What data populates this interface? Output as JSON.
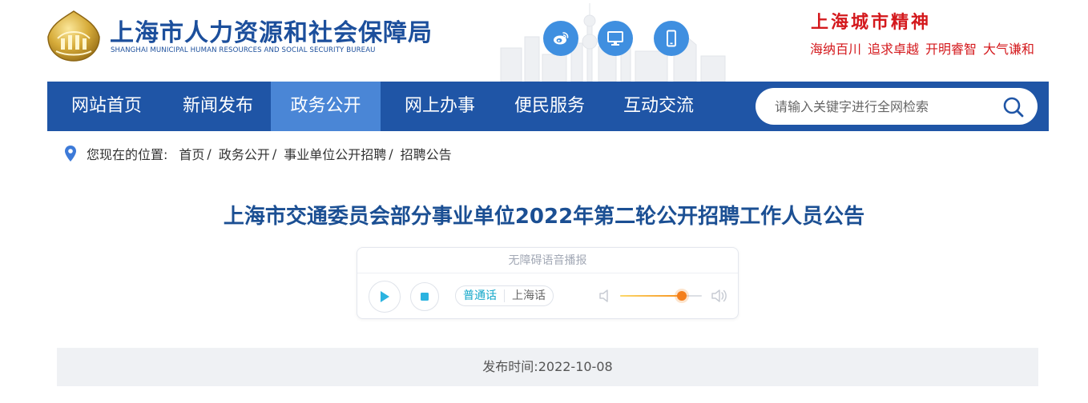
{
  "header": {
    "org_name_cn": "上海市人力资源和社会保障局",
    "org_name_en": "SHANGHAI MUNICIPAL HUMAN RESOURCES AND SOCIAL SECURITY BUREAU",
    "social": [
      {
        "name": "weibo-icon",
        "color": "#3f8fe0"
      },
      {
        "name": "desktop-icon",
        "color": "#3f8fe0"
      },
      {
        "name": "mobile-icon",
        "color": "#3f8fe0"
      }
    ],
    "spirit": {
      "title": "上海城市精神",
      "words": [
        "海纳百川",
        "追求卓越",
        "开明睿智",
        "大气谦和"
      ],
      "color": "#d4191d"
    }
  },
  "nav": {
    "items": [
      {
        "label": "网站首页"
      },
      {
        "label": "新闻发布"
      },
      {
        "label": "政务公开"
      },
      {
        "label": "网上办事"
      },
      {
        "label": "便民服务"
      },
      {
        "label": "互动交流"
      }
    ],
    "active_index": 2,
    "bg_color": "#1f55a6",
    "active_color": "#4a86d6",
    "search": {
      "placeholder": "请输入关键字进行全网检索",
      "value": ""
    }
  },
  "breadcrumb": {
    "prefix": "您现在的位置:",
    "items": [
      "首页",
      "政务公开",
      "事业单位公开招聘",
      "招聘公告"
    ],
    "separator": "/"
  },
  "article": {
    "title": "上海市交通委员会部分事业单位2022年第二轮公开招聘工作人员公告",
    "publish_label": "发布时间:",
    "publish_date": "2022-10-08"
  },
  "player": {
    "caption": "无障碍语音播报",
    "languages": [
      "普通话",
      "上海话"
    ],
    "active_language": "普通话",
    "volume_percent": 75
  }
}
